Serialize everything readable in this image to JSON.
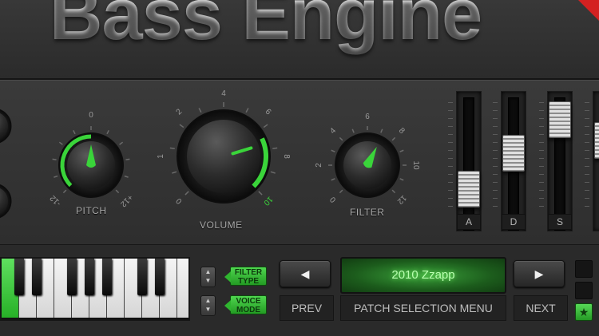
{
  "header": {
    "title": "Bass Engine"
  },
  "knobs": {
    "left_partial": {
      "tick": ""
    },
    "pitch": {
      "label": "PITCH",
      "tick_labels": [
        "0",
        "-12",
        "+12"
      ],
      "value": 0.5
    },
    "volume": {
      "label": "VOLUME",
      "tick_labels": [
        "0",
        "1",
        "2",
        "4",
        "6",
        "8",
        "10"
      ],
      "value": 0.77
    },
    "filter": {
      "label": "FILTER",
      "tick_labels": [
        "0",
        "2",
        "4",
        "6",
        "8",
        "10",
        "12"
      ],
      "value": 0.6
    }
  },
  "faders": [
    {
      "label": "A",
      "value": 0.28
    },
    {
      "label": "D",
      "value": 0.62
    },
    {
      "label": "S",
      "value": 0.95
    }
  ],
  "keyboard": {
    "active_key": 0
  },
  "controls": {
    "filter_type": "FILTER TYPE",
    "voice_mode": "VOICE MODE",
    "prev_arrow": "◀",
    "next_arrow": "▶",
    "patch_name": "2010 Zzapp",
    "prev_label": "PREV",
    "patch_menu_label": "PATCH SELECTION MENU",
    "next_label": "NEXT",
    "star": "★"
  },
  "colors": {
    "accent_green": "#3ad43a",
    "lcd_green": "#2f8f2f",
    "flag_red": "#d42121"
  }
}
